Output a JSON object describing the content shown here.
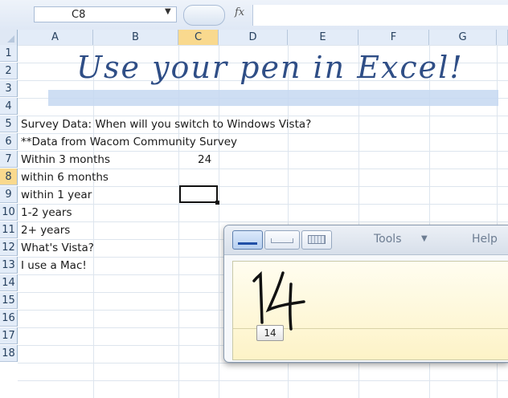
{
  "name_box": {
    "value": "C8"
  },
  "formula_bar": {
    "fx_label": "fx",
    "content": ""
  },
  "columns": [
    "A",
    "B",
    "C",
    "D",
    "E",
    "F",
    "G"
  ],
  "selected_column": "C",
  "rows": [
    "1",
    "2",
    "3",
    "4",
    "5",
    "6",
    "7",
    "8",
    "9",
    "10",
    "11",
    "12",
    "13",
    "14",
    "15",
    "16",
    "17",
    "18"
  ],
  "selected_row": "8",
  "handwritten_title": "Use your pen in Excel!",
  "cells": {
    "A5": "Survey Data:  When will you switch to Windows Vista?",
    "A6": "**Data from Wacom Community Survey",
    "A7": "Within 3 months",
    "C7": "24",
    "A8": "within 6 months",
    "A9": "within 1 year",
    "A10": "1-2 years",
    "A11": "2+ years",
    "A12": "What's Vista?",
    "A13": "I use a Mac!"
  },
  "input_panel": {
    "tabs": [
      "writing-pad",
      "character-pad",
      "on-screen-keyboard"
    ],
    "active_tab": "writing-pad",
    "menu_tools": "Tools",
    "menu_help": "Help",
    "handwriting": "14",
    "recognized_text": "14"
  },
  "colors": {
    "selected_header": "#f9d98e",
    "title_ink": "#2f4e86",
    "writing_area": "#fdf3c7"
  }
}
